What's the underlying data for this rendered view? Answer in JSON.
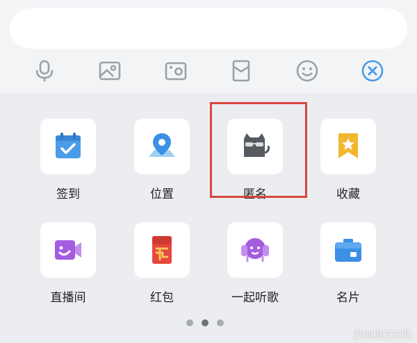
{
  "input": {
    "placeholder": ""
  },
  "toolbar": [
    {
      "icon": "microphone-icon"
    },
    {
      "icon": "image-icon"
    },
    {
      "icon": "camera-icon"
    },
    {
      "icon": "red-packet-outline-icon"
    },
    {
      "icon": "emoji-icon"
    },
    {
      "icon": "close-circle-icon"
    }
  ],
  "apps": [
    {
      "label": "签到",
      "icon": "calendar-check-icon"
    },
    {
      "label": "位置",
      "icon": "location-pin-icon"
    },
    {
      "label": "匿名",
      "icon": "anonymous-cat-icon"
    },
    {
      "label": "收藏",
      "icon": "bookmark-star-icon"
    },
    {
      "label": "直播间",
      "icon": "live-video-icon"
    },
    {
      "label": "红包",
      "icon": "red-packet-icon"
    },
    {
      "label": "一起听歌",
      "icon": "listen-together-icon"
    },
    {
      "label": "名片",
      "icon": "business-card-icon"
    }
  ],
  "pager": {
    "count": 3,
    "active": 1
  },
  "watermark": "爱创根知识网",
  "colors": {
    "accent_blue": "#4a9be8",
    "highlight_red": "#d9463f",
    "icon_gray": "#9aa0a8"
  }
}
